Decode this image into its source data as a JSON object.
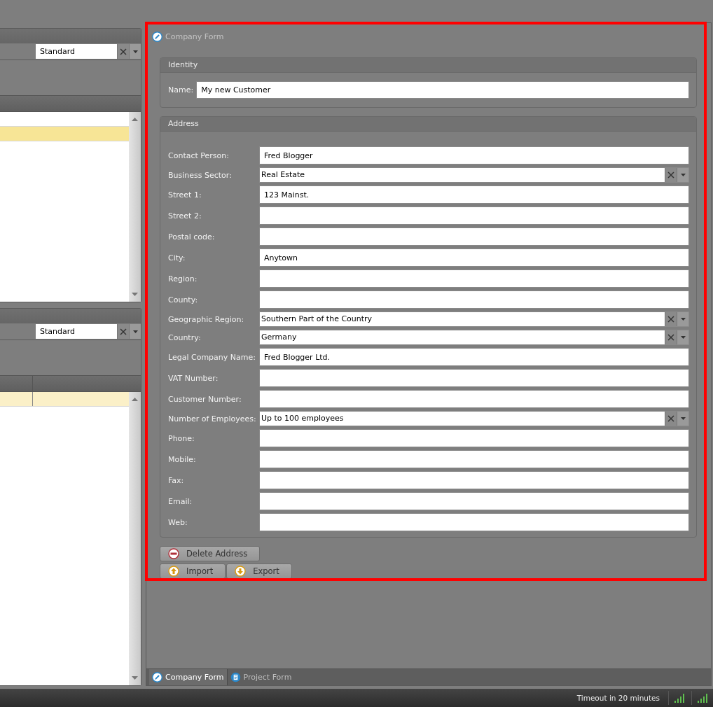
{
  "left_panels": [
    {
      "active": true,
      "filter": {
        "value": "Standard"
      },
      "kind": "single-column",
      "rows": [
        {
          "selected": false
        },
        {
          "selected": true
        }
      ]
    },
    {
      "active": false,
      "filter": {
        "value": "Standard"
      },
      "kind": "two-column",
      "rows": [
        {
          "selected": true
        }
      ]
    }
  ],
  "form": {
    "title": "Company Form",
    "identity": {
      "title": "Identity",
      "name_label": "Name:",
      "name_value": "My new Customer"
    },
    "address": {
      "title": "Address",
      "fields": [
        {
          "kind": "text",
          "label": "Contact Person:",
          "value": "Fred Blogger"
        },
        {
          "kind": "combo",
          "label": "Business Sector:",
          "value": "Real Estate"
        },
        {
          "kind": "text",
          "label": "Street 1:",
          "value": "123 Mainst."
        },
        {
          "kind": "text",
          "label": "Street 2:"
        },
        {
          "kind": "text",
          "label": "Postal code:"
        },
        {
          "kind": "text",
          "label": "City:",
          "value": "Anytown"
        },
        {
          "kind": "text",
          "label": "Region:"
        },
        {
          "kind": "text",
          "label": "County:"
        },
        {
          "kind": "combo",
          "label": "Geographic Region:",
          "value": "Southern Part of the Country"
        },
        {
          "kind": "combo",
          "label": "Country:",
          "value": "Germany"
        },
        {
          "kind": "text",
          "label": "Legal Company Name:",
          "value": "Fred Blogger Ltd."
        },
        {
          "kind": "text",
          "label": "VAT Number:"
        },
        {
          "kind": "text",
          "label": "Customer Number:"
        },
        {
          "kind": "combo",
          "label": "Number of Employees:",
          "value": "Up to 100 employees"
        },
        {
          "kind": "text",
          "label": "Phone:"
        },
        {
          "kind": "text",
          "label": "Mobile:"
        },
        {
          "kind": "text",
          "label": "Fax:"
        },
        {
          "kind": "text",
          "label": "Email:"
        },
        {
          "kind": "text",
          "label": "Web:"
        }
      ]
    },
    "buttons": [
      [
        {
          "kind": "delete",
          "label": "Delete Address"
        }
      ],
      [
        {
          "kind": "import",
          "label": "Import"
        },
        {
          "kind": "export",
          "label": "Export"
        }
      ]
    ]
  },
  "tabs": [
    {
      "kind": "pencil",
      "label": "Company Form",
      "selected": true
    },
    {
      "kind": "document",
      "label": "Project Form",
      "selected": false
    }
  ],
  "status_bar": {
    "text": "Timeout in 20 minutes"
  }
}
